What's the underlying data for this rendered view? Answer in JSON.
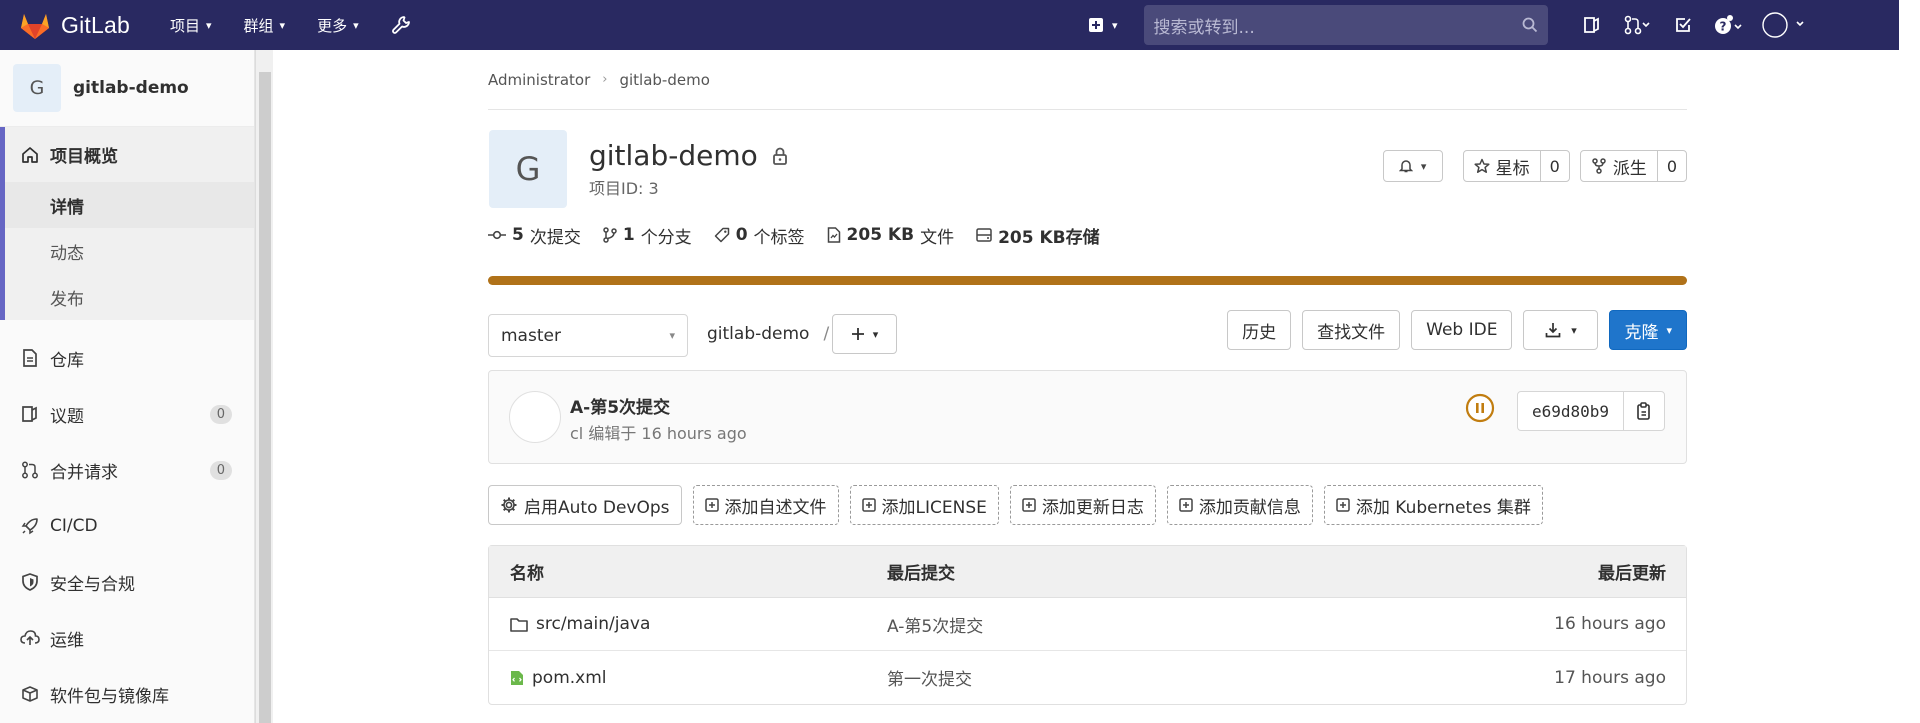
{
  "navbar": {
    "logo_text": "GitLab",
    "menu": [
      {
        "label": "项目"
      },
      {
        "label": "群组"
      },
      {
        "label": "更多"
      }
    ],
    "search_placeholder": "搜索或转到..."
  },
  "sidebar": {
    "project_initial": "G",
    "project_name": "gitlab-demo",
    "overview": {
      "label": "项目概览",
      "subs": [
        {
          "label": "详情",
          "active": true
        },
        {
          "label": "动态"
        },
        {
          "label": "发布"
        }
      ]
    },
    "items": [
      {
        "label": "仓库",
        "icon": "file-icon"
      },
      {
        "label": "议题",
        "icon": "issues-icon",
        "badge": "0"
      },
      {
        "label": "合并请求",
        "icon": "merge-request-icon",
        "badge": "0"
      },
      {
        "label": "CI/CD",
        "icon": "rocket-icon"
      },
      {
        "label": "安全与合规",
        "icon": "shield-icon"
      },
      {
        "label": "运维",
        "icon": "cloud-icon"
      },
      {
        "label": "软件包与镜像库",
        "icon": "package-icon"
      }
    ]
  },
  "breadcrumb": {
    "items": [
      "Administrator",
      "gitlab-demo"
    ]
  },
  "project": {
    "initial": "G",
    "name": "gitlab-demo",
    "id_text": "项目ID: 3",
    "star_label": "星标",
    "star_count": "0",
    "fork_label": "派生",
    "fork_count": "0"
  },
  "stats": [
    {
      "value": "5",
      "label": "次提交",
      "icon": "commit-icon"
    },
    {
      "value": "1",
      "label": "个分支",
      "icon": "branch-icon"
    },
    {
      "value": "0",
      "label": "个标签",
      "icon": "tag-icon"
    },
    {
      "value": "205 KB",
      "label": "文件",
      "icon": "file-size-icon"
    },
    {
      "value": "205 KB存储",
      "label": "",
      "icon": "storage-icon"
    }
  ],
  "language_bar": {
    "color": "#b07219",
    "percent": 100
  },
  "repo": {
    "branch": "master",
    "path": "gitlab-demo",
    "path_sep": "/",
    "history": "历史",
    "find_file": "查找文件",
    "web_ide": "Web IDE",
    "clone": "克隆"
  },
  "last_commit": {
    "title": "A-第5次提交",
    "meta": "cl 编辑于 16 hours ago",
    "sha": "e69d80b9"
  },
  "quick_actions": [
    {
      "label": "启用Auto DevOps",
      "style": "solid",
      "icon": "gear-icon"
    },
    {
      "label": "添加自述文件",
      "style": "dashed",
      "icon": "plus-square-icon"
    },
    {
      "label": "添加LICENSE",
      "style": "dashed",
      "icon": "plus-square-icon"
    },
    {
      "label": "添加更新日志",
      "style": "dashed",
      "icon": "plus-square-icon"
    },
    {
      "label": "添加贡献信息",
      "style": "dashed",
      "icon": "plus-square-icon"
    },
    {
      "label": "添加 Kubernetes 集群",
      "style": "dashed",
      "icon": "plus-square-icon"
    }
  ],
  "file_tree": {
    "headers": {
      "name": "名称",
      "commit": "最后提交",
      "date": "最后更新"
    },
    "rows": [
      {
        "name": "src/main/java",
        "type": "folder",
        "commit": "A-第5次提交",
        "date": "16 hours ago"
      },
      {
        "name": "pom.xml",
        "type": "file",
        "commit": "第一次提交",
        "date": "17 hours ago"
      }
    ]
  },
  "colors": {
    "navbar": "#292961",
    "accent": "#6666c4",
    "primary_button": "#1f75cb",
    "pipeline_status": "#c17d10"
  }
}
